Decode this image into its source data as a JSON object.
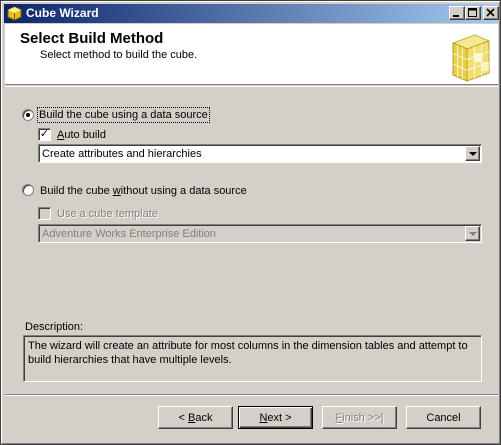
{
  "window": {
    "title": "Cube Wizard"
  },
  "header": {
    "title": "Select Build Method",
    "subtitle": "Select method to build the cube."
  },
  "options": {
    "with_source": {
      "label_pre": "Build the cube using a data source",
      "selected": true
    },
    "auto_build": {
      "label": "Auto build",
      "checked": true
    },
    "auto_build_mode": {
      "value": "Create attributes and hierarchies"
    },
    "without_source": {
      "label_pre": "Build the cube ",
      "label_mn": "w",
      "label_post": "ithout using a data source",
      "selected": false
    },
    "use_template": {
      "label": "Use a cube template",
      "checked": false
    },
    "template": {
      "value": "Adventure Works Enterprise Edition"
    }
  },
  "description": {
    "label": "Description:",
    "text": "The wizard will create an attribute for most columns in the dimension tables and attempt to build hierarchies that have multiple levels."
  },
  "buttons": {
    "back_pre": "< ",
    "back_mn": "B",
    "back_post": "ack",
    "next_mn": "N",
    "next_post": "ext >",
    "finish_mn": "F",
    "finish_post": "inish >>|",
    "cancel": "Cancel"
  },
  "colors": {
    "titlebar_start": "#0a246a",
    "titlebar_end": "#a6caf0",
    "face": "#d4d0c8"
  }
}
